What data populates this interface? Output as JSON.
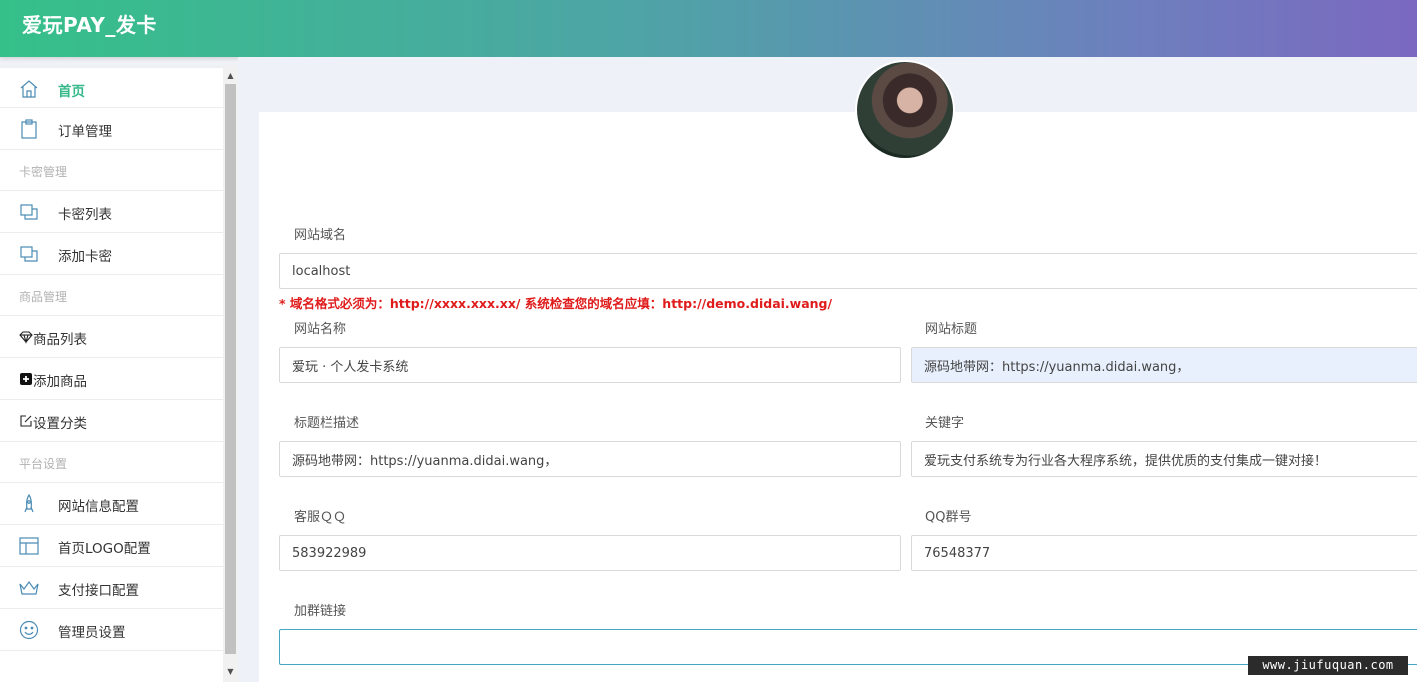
{
  "app": {
    "title": "爱玩PAY_发卡"
  },
  "sidebar": {
    "items": [
      {
        "type": "item",
        "label": "首页",
        "icon": "home-icon",
        "active": true
      },
      {
        "type": "item",
        "label": "订单管理",
        "icon": "clipboard-icon"
      },
      {
        "type": "group",
        "label": "卡密管理"
      },
      {
        "type": "item",
        "label": "卡密列表",
        "icon": "copy-icon"
      },
      {
        "type": "item",
        "label": "添加卡密",
        "icon": "copy-icon"
      },
      {
        "type": "group",
        "label": "商品管理"
      },
      {
        "type": "item",
        "label": "商品列表",
        "icon": "diamond-icon"
      },
      {
        "type": "item",
        "label": "添加商品",
        "icon": "plus-square-icon"
      },
      {
        "type": "item",
        "label": "设置分类",
        "icon": "edit-icon"
      },
      {
        "type": "group",
        "label": "平台设置"
      },
      {
        "type": "item",
        "label": "网站信息配置",
        "icon": "rocket-icon"
      },
      {
        "type": "item",
        "label": "首页LOGO配置",
        "icon": "layout-icon"
      },
      {
        "type": "item",
        "label": "支付接口配置",
        "icon": "crown-icon"
      },
      {
        "type": "item",
        "label": "管理员设置",
        "icon": "smile-icon"
      }
    ]
  },
  "form": {
    "domain": {
      "label": "网站域名",
      "value": "localhost"
    },
    "hint": "* 域名格式必须为：http://xxxx.xxx.xx/ 系统检查您的域名应填：http://demo.didai.wang/",
    "site_name": {
      "label": "网站名称",
      "value": "爱玩 · 个人发卡系统"
    },
    "site_title": {
      "label": "网站标题",
      "value": "源码地带网：https://yuanma.didai.wang，"
    },
    "title_desc": {
      "label": "标题栏描述",
      "value": "源码地带网：https://yuanma.didai.wang，"
    },
    "keywords": {
      "label": "关键字",
      "value": "爱玩支付系统专为行业各大程序系统，提供优质的支付集成一键对接！"
    },
    "qq": {
      "label": "客服ＱＱ",
      "value": "583922989"
    },
    "qq_group": {
      "label": "QQ群号",
      "value": "76548377"
    },
    "group_link": {
      "label": "加群链接",
      "value": ""
    }
  },
  "watermark": "www.jiufuquan.com",
  "colors": {
    "accent": "#35b98a",
    "hint": "#e01b1b",
    "header_start": "#35c089",
    "header_end": "#7b68c0"
  }
}
